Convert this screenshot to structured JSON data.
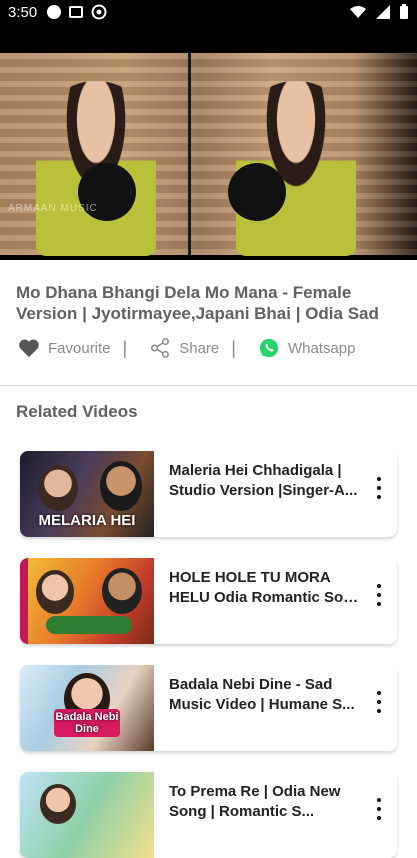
{
  "status_bar": {
    "time": "3:50",
    "left_icons": [
      "notification-dot-icon",
      "gmail-icon",
      "at-sign-icon"
    ],
    "right_icons": [
      "wifi-icon",
      "signal-icon",
      "battery-icon"
    ]
  },
  "player": {
    "watermark": "ARMAAN MUSIC"
  },
  "video": {
    "title": "Mo Dhana Bhangi Dela Mo Mana - Female Version | Jyotirmayee,Japani Bhai | Odia Sad"
  },
  "actions": {
    "favourite": {
      "label": "Favourite",
      "icon": "heart-icon"
    },
    "share": {
      "label": "Share",
      "icon": "share-icon"
    },
    "whatsapp": {
      "label": "Whatsapp",
      "icon": "whatsapp-icon",
      "color": "#25D366"
    },
    "separator": "|"
  },
  "related": {
    "heading": "Related Videos",
    "items": [
      {
        "title_line1": "Maleria Hei Chhadigala |",
        "title_line2": "Studio Version |Singer-A...",
        "thumb_label": "MELARIA HEI"
      },
      {
        "title_line1": "HOLE HOLE TU MORA",
        "title_line2": "HELU Odia Romantic Son...",
        "thumb_label": ""
      },
      {
        "title_line1": "Badala Nebi Dine - Sad",
        "title_line2": "Music Video | Humane S...",
        "thumb_label": "Badala Nebi Dine"
      },
      {
        "title_line1": "To Prema Re | Odia New",
        "title_line2": "Song | Romantic S...",
        "thumb_label": ""
      }
    ]
  }
}
